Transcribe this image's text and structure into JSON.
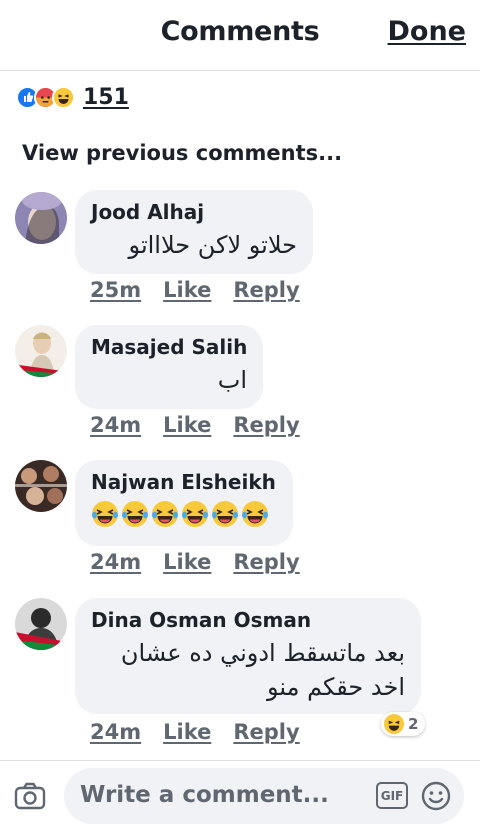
{
  "header": {
    "title": "Comments",
    "done_label": "Done"
  },
  "reactions": {
    "icons": [
      "like-icon",
      "angry-icon",
      "haha-icon"
    ],
    "count": "151"
  },
  "view_previous": "View previous comments...",
  "comments": [
    {
      "author": "Jood Alhaj",
      "text": "حلاتو لاكن حلاااتو",
      "time": "25m",
      "like_label": "Like",
      "reply_label": "Reply"
    },
    {
      "author": "Masajed Salih",
      "text": "اب",
      "time": "24m",
      "like_label": "Like",
      "reply_label": "Reply"
    },
    {
      "author": "Najwan Elsheikh",
      "emoji_count": 6,
      "emoji_icon": "laughing-tears-icon",
      "time": "24m",
      "like_label": "Like",
      "reply_label": "Reply"
    },
    {
      "author": "Dina Osman Osman",
      "text_line1": "بعد ماتسقط ادوني ده عشان",
      "text_line2": "اخد حقكم منو",
      "time": "24m",
      "like_label": "Like",
      "reply_label": "Reply",
      "reaction_badge": {
        "icon": "haha-icon",
        "count": "2"
      }
    }
  ],
  "composer": {
    "placeholder": "Write a comment...",
    "gif_label": "GIF",
    "icons": [
      "camera-icon",
      "gif-icon",
      "smiley-icon"
    ]
  },
  "colors": {
    "bubble": "#f0f2f5",
    "meta_text": "#606770",
    "like_blue": "#1877f2",
    "angry_red": "#e9710f",
    "haha_yellow": "#f7b928"
  }
}
